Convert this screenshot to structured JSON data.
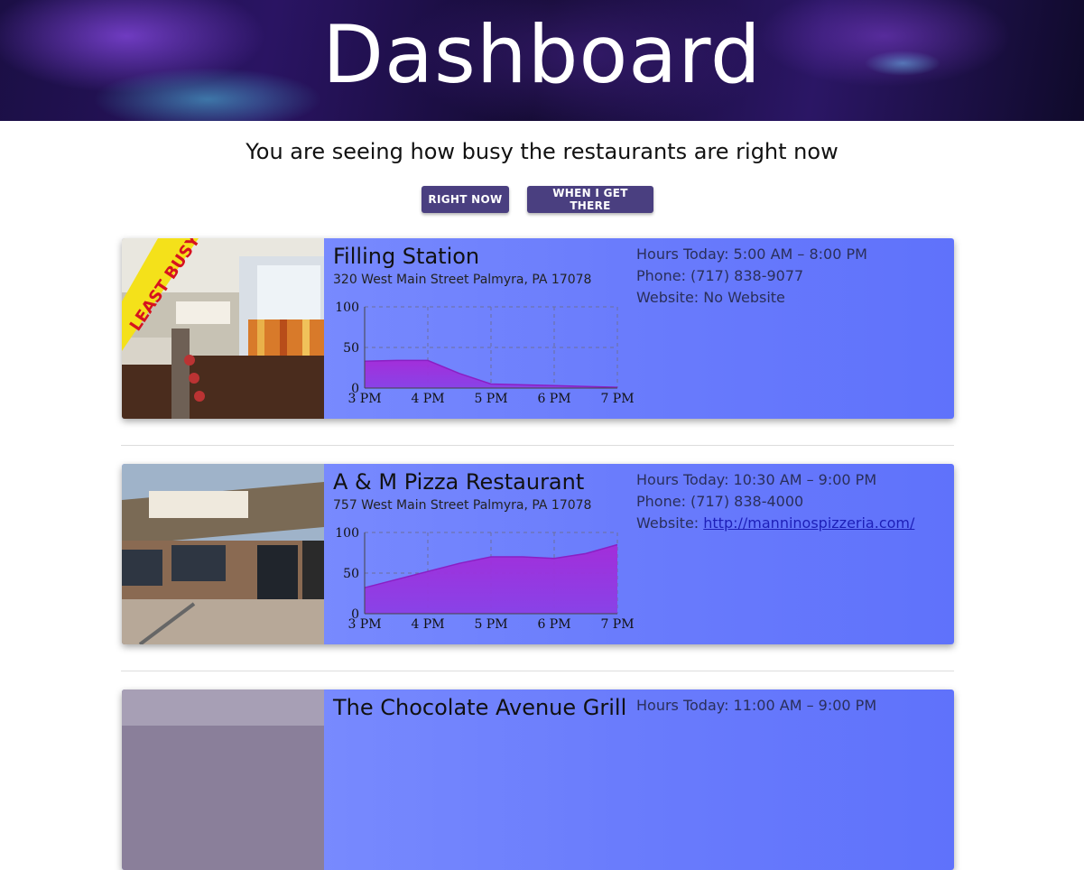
{
  "header": {
    "title": "Dashboard"
  },
  "subtitle": "You are seeing how busy the restaurants are right now",
  "buttons": {
    "right_now": "RIGHT NOW",
    "when_i_get_there": "WHEN I GET THERE"
  },
  "colors": {
    "button_bg": "#4a3f80",
    "card_bg": "#7385fd",
    "series_fill": "#9c2fd6",
    "badge_bg": "#f4e11a",
    "badge_text": "#d6121f"
  },
  "restaurants": [
    {
      "name": "Filling Station",
      "address": "320 West Main Street Palmyra, PA 17078",
      "badge": "LEAST BUSY",
      "hours": "Hours Today: 5:00 AM – 8:00 PM",
      "phone": "Phone: (717) 838-9077",
      "website_label": "Website: ",
      "website": "No Website",
      "website_is_link": false
    },
    {
      "name": "A & M Pizza Restaurant",
      "address": "757 West Main Street Palmyra, PA 17078",
      "hours": "Hours Today: 10:30 AM – 9:00 PM",
      "phone": "Phone: (717) 838-4000",
      "website_label": "Website: ",
      "website": "http://manninospizzeria.com/",
      "website_is_link": true
    },
    {
      "name": "The Chocolate Avenue Grill",
      "hours": "Hours Today: 11:00 AM – 9:00 PM"
    }
  ],
  "chart_data": [
    {
      "type": "area",
      "categories": [
        "3 PM",
        "4 PM",
        "5 PM",
        "6 PM",
        "7 PM"
      ],
      "x": [
        0,
        0.5,
        1,
        1.5,
        2,
        2.5,
        3,
        3.5,
        4
      ],
      "values": [
        33,
        34,
        34,
        18,
        5,
        4,
        3,
        2,
        1
      ],
      "yticks": [
        0,
        50,
        100
      ],
      "ylim": [
        0,
        100
      ],
      "grid": true
    },
    {
      "type": "area",
      "categories": [
        "3 PM",
        "4 PM",
        "5 PM",
        "6 PM",
        "7 PM"
      ],
      "x": [
        0,
        0.5,
        1,
        1.5,
        2,
        2.5,
        3,
        3.5,
        4
      ],
      "values": [
        32,
        42,
        52,
        62,
        70,
        70,
        68,
        74,
        85
      ],
      "yticks": [
        0,
        50,
        100
      ],
      "ylim": [
        0,
        100
      ],
      "grid": true
    }
  ]
}
